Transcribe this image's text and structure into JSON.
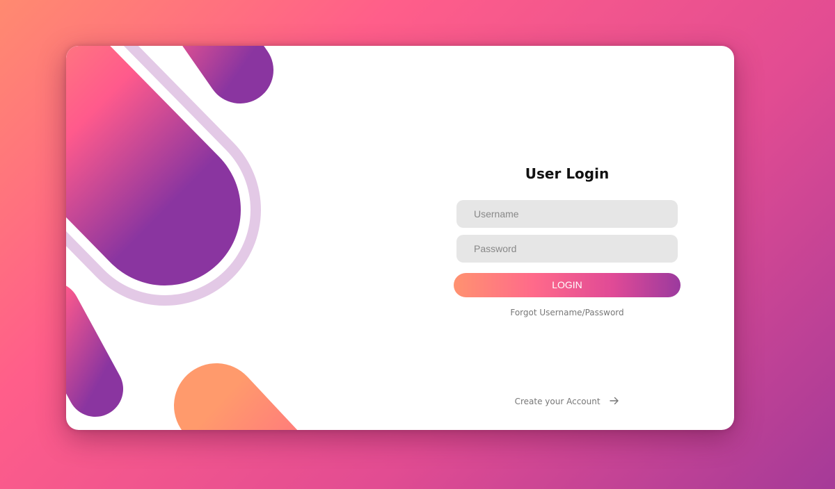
{
  "login": {
    "title": "User Login",
    "username_placeholder": "Username",
    "password_placeholder": "Password",
    "login_label": "LOGIN",
    "forgot_label": "Forgot Username/Password",
    "create_label": "Create your Account"
  },
  "icons": {
    "create_arrow": "arrow-right-icon"
  },
  "colors": {
    "gradient_start": "#ff9270",
    "gradient_mid": "#ff5e8a",
    "gradient_end": "#9b3a9e",
    "card_background": "#ffffff",
    "input_background": "#e6e6e6",
    "decor_ring": "#e3c9e6"
  }
}
